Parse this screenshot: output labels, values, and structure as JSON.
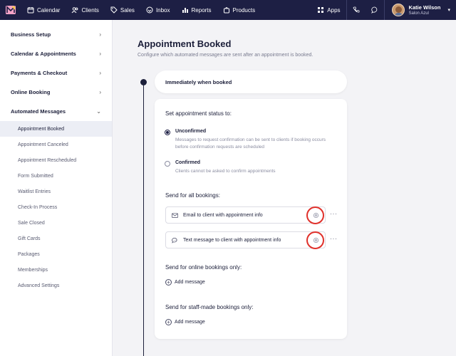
{
  "nav": {
    "items": [
      {
        "label": "Calendar",
        "icon": "calendar-icon"
      },
      {
        "label": "Clients",
        "icon": "users-icon"
      },
      {
        "label": "Sales",
        "icon": "tag-icon"
      },
      {
        "label": "Inbox",
        "icon": "inbox-icon"
      },
      {
        "label": "Reports",
        "icon": "bar-chart-icon"
      },
      {
        "label": "Products",
        "icon": "bag-icon"
      }
    ],
    "apps_label": "Apps",
    "user": {
      "name": "Katie Wilson",
      "location": "Salon Azul"
    }
  },
  "sidebar": {
    "groups": [
      {
        "label": "Business Setup",
        "chevron": "›"
      },
      {
        "label": "Calendar & Appointments",
        "chevron": "›"
      },
      {
        "label": "Payments & Checkout",
        "chevron": "›"
      },
      {
        "label": "Online Booking",
        "chevron": "›"
      },
      {
        "label": "Automated Messages",
        "chevron": "⌄"
      }
    ],
    "subitems": [
      {
        "label": "Appointment Booked",
        "active": true
      },
      {
        "label": "Appointment Canceled",
        "active": false
      },
      {
        "label": "Appointment Rescheduled",
        "active": false
      },
      {
        "label": "Form Submitted",
        "active": false
      },
      {
        "label": "Waitlist Entries",
        "active": false
      },
      {
        "label": "Check-In Process",
        "active": false
      },
      {
        "label": "Sale Closed",
        "active": false
      },
      {
        "label": "Gift Cards",
        "active": false
      },
      {
        "label": "Packages",
        "active": false
      },
      {
        "label": "Memberships",
        "active": false
      },
      {
        "label": "Advanced Settings",
        "active": false
      }
    ]
  },
  "main": {
    "title": "Appointment Booked",
    "subtitle": "Configure which automated messages are sent after an appointment is booked.",
    "trigger": "Immediately when booked",
    "status_label": "Set appointment status to:",
    "status_options": [
      {
        "title": "Unconfirmed",
        "desc": "Messages to request confirmation can be sent to clients if booking occurs before confirmation requests are scheduled",
        "checked": true
      },
      {
        "title": "Confirmed",
        "desc": "Clients cannot be asked to confirm appointments",
        "checked": false
      }
    ],
    "all_bookings_label": "Send for all bookings:",
    "messages": [
      {
        "label": "Email to client with appointment info",
        "icon": "mail-icon"
      },
      {
        "label": "Text message to client with appointment info",
        "icon": "chat-bubble-icon"
      }
    ],
    "more_label": "···",
    "online_label": "Send for online bookings only:",
    "staff_label": "Send for staff-made bookings only:",
    "add_message_label": "Add message"
  },
  "colors": {
    "nav_bg": "#1d1f44",
    "highlight": "#e0312b",
    "active_bg": "#eceef5"
  }
}
